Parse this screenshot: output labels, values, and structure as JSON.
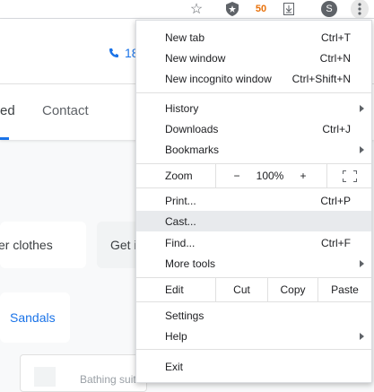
{
  "toolbar": {
    "orange_badge": "50",
    "avatar_letter": "S",
    "icons": [
      "star-icon",
      "shield-extension-icon",
      "orange-extension-icon",
      "download-extension-icon",
      "avatar",
      "more-menu-icon"
    ]
  },
  "page": {
    "phone_partial": "18",
    "nav_active_partial": "ed",
    "nav_contact": "Contact",
    "card_clothes": "er clothes",
    "card_get": "Get i",
    "card_sandals": "Sandals",
    "card_bathing": "Bathing suits"
  },
  "menu": {
    "new_tab": "New tab",
    "new_tab_sc": "Ctrl+T",
    "new_window": "New window",
    "new_window_sc": "Ctrl+N",
    "new_incognito": "New incognito window",
    "new_incognito_sc": "Ctrl+Shift+N",
    "history": "History",
    "downloads": "Downloads",
    "downloads_sc": "Ctrl+J",
    "bookmarks": "Bookmarks",
    "zoom_label": "Zoom",
    "zoom_minus": "−",
    "zoom_value": "100%",
    "zoom_plus": "+",
    "print": "Print...",
    "print_sc": "Ctrl+P",
    "cast": "Cast...",
    "find": "Find...",
    "find_sc": "Ctrl+F",
    "more_tools": "More tools",
    "edit_label": "Edit",
    "cut": "Cut",
    "copy": "Copy",
    "paste": "Paste",
    "settings": "Settings",
    "help": "Help",
    "exit": "Exit"
  },
  "colors": {
    "accent": "#1a73e8",
    "highlight": "#e8eaed"
  }
}
